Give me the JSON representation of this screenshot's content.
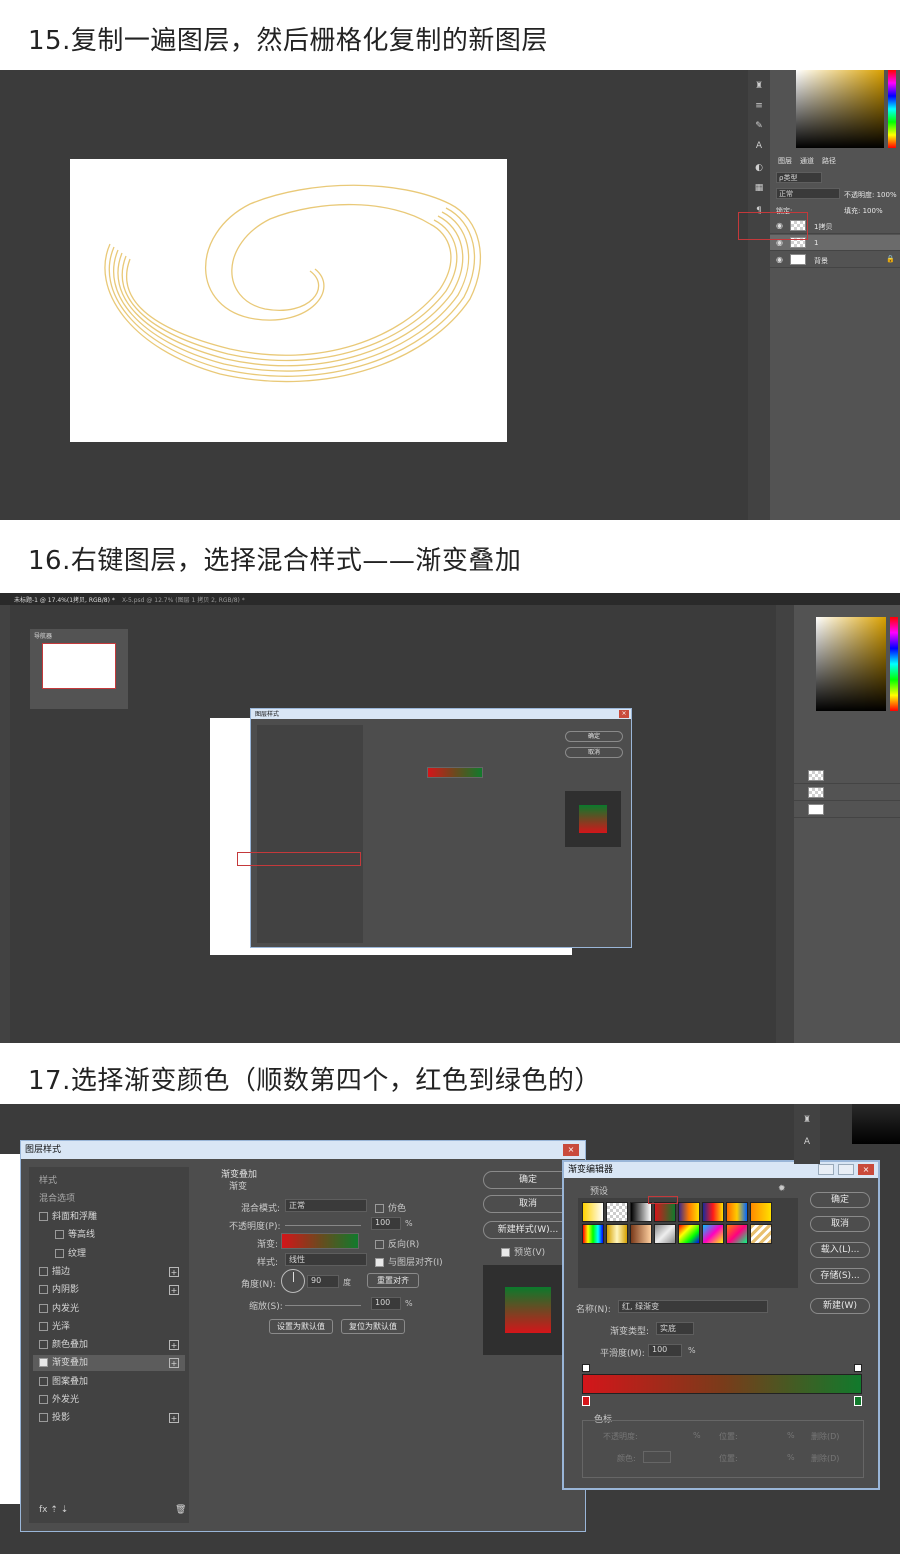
{
  "steps": [
    {
      "heading": "15.复制一遍图层，然后栅格化复制的新图层"
    },
    {
      "heading": "16.右键图层，选择混合样式——渐变叠加"
    },
    {
      "heading": "17.选择渐变颜色（顺数第四个，红色到绿色的）"
    }
  ],
  "layers_panel": {
    "tabs": [
      "图层",
      "通道",
      "路径"
    ],
    "kind_filter": "ρ类型",
    "blend_mode": "正常",
    "opacity_label": "不透明度: 100%",
    "lock_label": "锁定:",
    "fill_label": "填充: 100%",
    "layers": [
      {
        "name": "1拷贝",
        "selected": false
      },
      {
        "name": "1",
        "selected": true
      },
      {
        "name": "背景",
        "selected": false
      }
    ]
  },
  "doc_tabs": [
    "未标题-1 @ 17.4%(1拷贝, RGB/8) *",
    "X-5.psd @ 12.7% (图层 1 拷贝 2, RGB/8) *"
  ],
  "navigator": {
    "title": "导航器"
  },
  "layer_style": {
    "title": "图层样式",
    "list_header": "样式",
    "blend_options": "混合选项",
    "items": [
      {
        "label": "斜面和浮雕",
        "checked": false,
        "plus": false,
        "indent": false
      },
      {
        "label": "等高线",
        "checked": false,
        "plus": false,
        "indent": true
      },
      {
        "label": "纹理",
        "checked": false,
        "plus": false,
        "indent": true
      },
      {
        "label": "描边",
        "checked": false,
        "plus": true,
        "indent": false
      },
      {
        "label": "内阴影",
        "checked": false,
        "plus": true,
        "indent": false
      },
      {
        "label": "内发光",
        "checked": false,
        "plus": false,
        "indent": false
      },
      {
        "label": "光泽",
        "checked": false,
        "plus": false,
        "indent": false
      },
      {
        "label": "颜色叠加",
        "checked": false,
        "plus": true,
        "indent": false
      },
      {
        "label": "渐变叠加",
        "checked": true,
        "plus": true,
        "indent": false
      },
      {
        "label": "图案叠加",
        "checked": false,
        "plus": false,
        "indent": false
      },
      {
        "label": "外发光",
        "checked": false,
        "plus": false,
        "indent": false
      },
      {
        "label": "投影",
        "checked": false,
        "plus": true,
        "indent": false
      }
    ],
    "footer_icons": "fx ⇡ ⇣",
    "section_title": "渐变叠加",
    "sub_title": "渐变",
    "blend_mode_label": "混合模式:",
    "blend_mode_value": "正常",
    "dither_label": "仿色",
    "opacity_label": "不透明度(P):",
    "opacity_value": "100",
    "pct": "%",
    "gradient_label": "渐变:",
    "reverse_label": "反向(R)",
    "style_label": "样式:",
    "style_value": "线性",
    "align_label": "与图层对齐(I)",
    "angle_label": "角度(N):",
    "angle_value": "90",
    "degree": "度",
    "reset_align": "重置对齐",
    "scale_label": "缩放(S):",
    "scale_value": "100",
    "set_default": "设置为默认值",
    "reset_default": "复位为默认值",
    "ok": "确定",
    "cancel": "取消",
    "new_style": "新建样式(W)...",
    "preview": "预览(V)"
  },
  "gradient_editor": {
    "title": "渐变编辑器",
    "presets_label": "预设",
    "ok": "确定",
    "cancel": "取消",
    "load": "载入(L)...",
    "save": "存储(S)...",
    "name_label": "名称(N):",
    "name_value": "红, 绿渐变",
    "new": "新建(W)",
    "type_label": "渐变类型:",
    "type_value": "实底",
    "smooth_label": "平滑度(M):",
    "smooth_value": "100",
    "pct": "%",
    "stops_title": "色标",
    "opacity_label": "不透明度:",
    "location_label": "位置:",
    "delete_label": "删除(D)",
    "color_label": "颜色:",
    "location2_label": "位置:",
    "delete2_label": "删除(D)"
  },
  "colors": {
    "ps_bg": "#3b3b3b",
    "panel": "#535353",
    "gold": "#e9c978",
    "red": "#d4151a",
    "green": "#117a2c",
    "highlight": "#c4393b"
  }
}
